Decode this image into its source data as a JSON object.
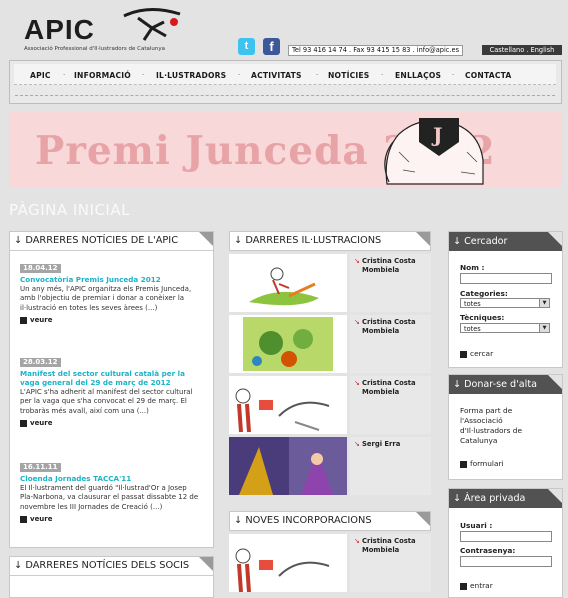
{
  "header": {
    "logo_text": "APIC",
    "logo_subtitle": "Associació Professional d'Il·lustradors de Catalunya",
    "social": {
      "twitter_icon": "twitter-icon",
      "facebook_icon": "facebook-icon",
      "twitter_glyph": "t",
      "facebook_glyph": "f"
    },
    "contact": "Tel 93 416 14 74 . Fax 93 415 15 83 . info@apic.es",
    "languages": "Castellano . English"
  },
  "nav": {
    "items": [
      "APIC",
      "INFORMACIÓ",
      "IL·LUSTRADORS",
      "ACTIVITATS",
      "NOTÍCIES",
      "ENLLAÇOS",
      "CONTACTA"
    ],
    "separator": "·"
  },
  "banner": {
    "title": "Premi Junceda 2012"
  },
  "page_title": "PÀGINA INICIAL",
  "news": {
    "heading": "↓ DARRERES NOTÍCIES DE L'APIC",
    "items": [
      {
        "date": "18.04.12",
        "title": "Convocatòria Premis Junceda 2012",
        "text": "Un any més, l'APIC organitza els Premis Junceda, amb l'objectiu de premiar i donar a conèixer la il·lustració en totes les seves àrees (...)",
        "more": "veure"
      },
      {
        "date": "28.03.12",
        "title": "Manifest del sector cultural català per la vaga general del 29 de març de 2012",
        "text": "L'APIC s'ha adherit al manifest del sector cultural per la vaga que s'ha convocat el 29 de març. El trobaràs més avall, així com una (...)",
        "more": "veure"
      },
      {
        "date": "16.11.11",
        "title": "Cloenda Jornades TACCA'11",
        "text": "El Il·lustrament del guardó \"Il·lustrad'Or a Josep Pla-Narbona, va clausurar el passat dissabte 12 de novembre les III Jornades de Creació (...)",
        "more": "veure"
      }
    ]
  },
  "members_news": {
    "heading": "↓ DARRERES NOTÍCIES DELS SOCIS"
  },
  "illustrations": {
    "heading": "↓ DARRERES IL·LUSTRACIONS",
    "items": [
      {
        "author": "Cristina Costa Mombiela"
      },
      {
        "author": "Cristina Costa Mombiela"
      },
      {
        "author": "Cristina Costa Mombiela"
      },
      {
        "author": "Sergi Erra"
      }
    ]
  },
  "new_members": {
    "heading": "↓ NOVES INCORPORACIONS",
    "items": [
      {
        "author": "Cristina Costa Mombiela"
      }
    ]
  },
  "search": {
    "heading": "↓ Cercador",
    "name_label": "Nom :",
    "categories_label": "Categories:",
    "categories_value": "totes",
    "techniques_label": "Tècniques:",
    "techniques_value": "totes",
    "button": "cercar"
  },
  "signup": {
    "heading": "↓ Donar-se d'alta",
    "text": "Forma part de l'Associació d'Il·lustradors de Catalunya",
    "button": "formulari"
  },
  "private": {
    "heading": "↓ Àrea privada",
    "user_label": "Usuari :",
    "password_label": "Contrasenya:",
    "button": "entrar"
  },
  "colors": {
    "accent": "#1ab3c8",
    "banner_bg": "#f8d8d9",
    "banner_text": "#e8a3a6",
    "dark_header": "#525252"
  }
}
